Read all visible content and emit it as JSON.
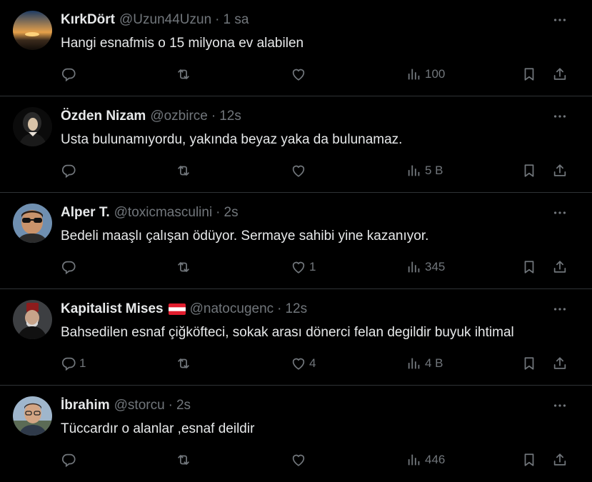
{
  "colors": {
    "background": "#000000",
    "text": "#e7e9ea",
    "muted": "#71767b",
    "divider": "#2f3336"
  },
  "tweets": [
    {
      "name": "KırkDört",
      "handle": "@Uzun44Uzun",
      "time": "1 sa",
      "text": "Hangi esnafmis o 15 milyona ev alabilen",
      "replies": "",
      "likes": "",
      "views": "100",
      "avatar_icon": "sunset-avatar"
    },
    {
      "name": "Özden Nizam",
      "handle": "@ozbirce",
      "time": "12s",
      "text": "Usta bulunamıyordu, yakında beyaz yaka da bulunamaz.",
      "replies": "",
      "likes": "",
      "views": "5 B",
      "avatar_icon": "woman-portrait-avatar"
    },
    {
      "name": "Alper T.",
      "handle": "@toxicmasculini",
      "time": "2s",
      "text": "Bedeli maaşlı çalışan ödüyor. Sermaye sahibi yine kazanıyor.",
      "replies": "",
      "likes": "1",
      "views": "345",
      "avatar_icon": "sunglasses-man-avatar"
    },
    {
      "name": "Kapitalist Mises",
      "handle": "@natocugenc",
      "time": "12s",
      "text": "Bahsedilen esnaf çiğköfteci, sokak arası dönerci felan degildir buyuk ihtimal",
      "replies": "1",
      "likes": "4",
      "views": "4 B",
      "avatar_icon": "fez-man-avatar",
      "flag_icon": "austria-flag-icon"
    },
    {
      "name": "İbrahim",
      "handle": "@storcu",
      "time": "2s",
      "text": "Tüccardır o alanlar ,esnaf deildir",
      "replies": "",
      "likes": "",
      "views": "446",
      "avatar_icon": "glasses-man-avatar"
    }
  ],
  "separator": "·"
}
